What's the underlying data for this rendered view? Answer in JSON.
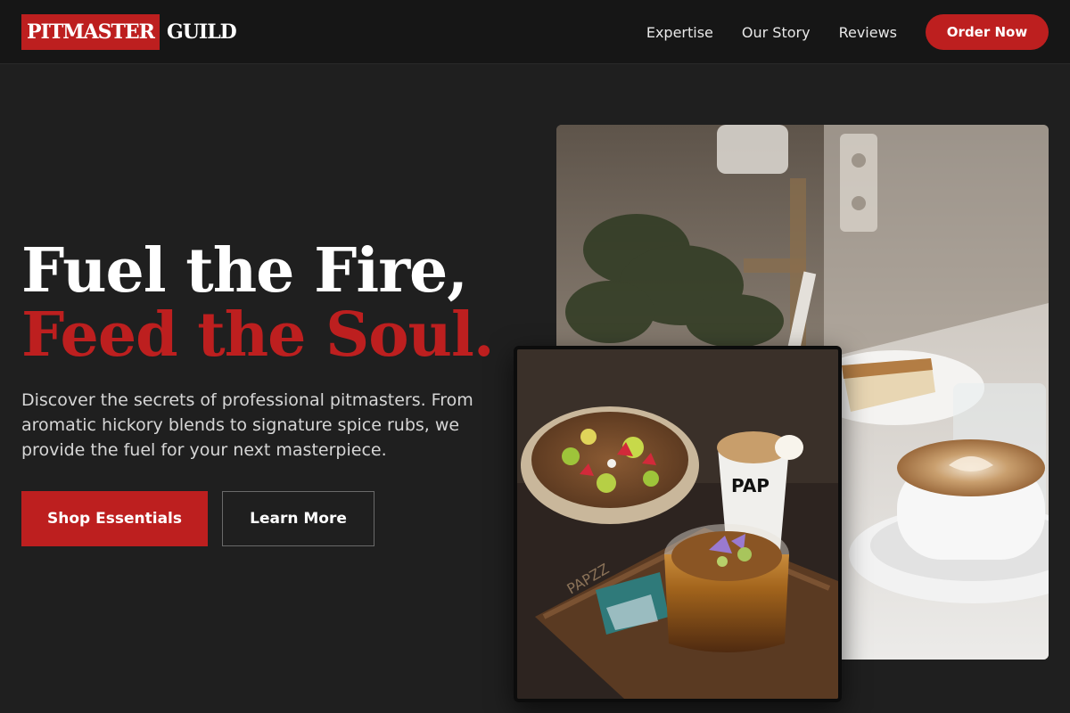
{
  "brand": {
    "mark": "PITMASTER",
    "word": "GUILD",
    "accent_color": "#bd1f1f",
    "background_color": "#1f1f1f"
  },
  "nav": {
    "links": [
      "Expertise",
      "Our Story",
      "Reviews"
    ],
    "cta": "Order Now"
  },
  "hero": {
    "headline_line1": "Fuel the Fire,",
    "headline_line2": "Feed the Soul.",
    "description": "Discover the secrets of professional pitmasters. From aromatic hickory blends to signature spice rubs, we provide the fuel for your next masterpiece.",
    "primary_button": "Shop Essentials",
    "secondary_button": "Learn More"
  },
  "images": {
    "back": {
      "subject": "cafe table with latte and cheesecake"
    },
    "front": {
      "subject": "bowl and drinks on wooden tray",
      "cup_text": "PAP",
      "tray_text": "PAPZZ"
    }
  }
}
